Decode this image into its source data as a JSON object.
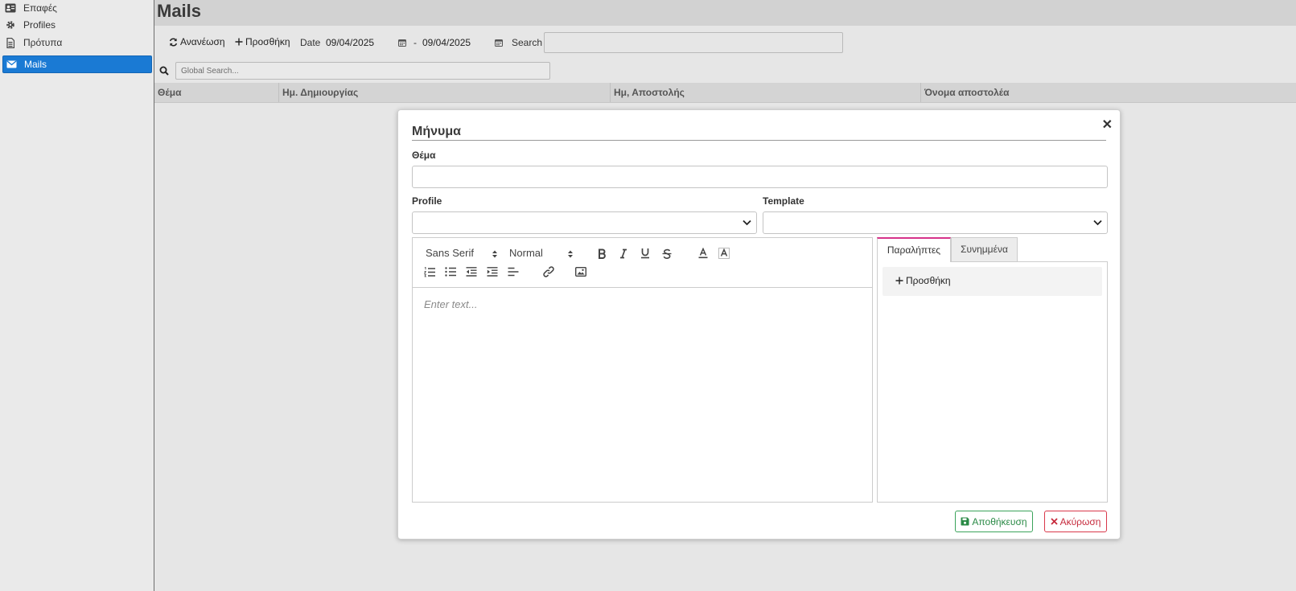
{
  "sidebar": {
    "items": [
      {
        "label": "Επαφές",
        "icon": "contacts-card-icon",
        "active": false
      },
      {
        "label": "Profiles",
        "icon": "gear-icon",
        "active": false
      },
      {
        "label": "Πρότυπα",
        "icon": "template-document-icon",
        "active": false
      },
      {
        "label": "Mails",
        "icon": "envelope-icon",
        "active": true
      }
    ]
  },
  "main": {
    "title": "Mails",
    "toolbar": {
      "refresh_label": "Ανανέωση",
      "add_label": "Προσθήκη",
      "date_label": "Date",
      "date_from": "09/04/2025",
      "date_separator": "-",
      "date_to": "09/04/2025",
      "search_label": "Search",
      "search_value": ""
    },
    "global_search": {
      "placeholder": "Global Search...",
      "value": ""
    },
    "table": {
      "columns": [
        "Θέμα",
        "Ημ. Δημιουργίας",
        "Ημ, Αποστολής",
        "Όνομα αποστολέα"
      ],
      "rows": []
    }
  },
  "modal": {
    "title": "Μήνυμα",
    "close_icon": "close-icon",
    "subject_label": "Θέμα",
    "subject_value": "",
    "profile_label": "Profile",
    "profile_value": "",
    "template_label": "Template",
    "template_value": "",
    "editor": {
      "font": "Sans Serif",
      "size": "Normal",
      "placeholder": "Enter text...",
      "content": ""
    },
    "tabs": [
      {
        "label": "Παραλήπτες",
        "active": true
      },
      {
        "label": "Συνημμένα",
        "active": false
      }
    ],
    "add_recipient_label": "Προσθήκη",
    "save_label": "Αποθήκευση",
    "cancel_label": "Ακύρωση"
  },
  "colors": {
    "accent": "#1a7ad4",
    "tab_active": "#d6338a",
    "save": "#2a8a46",
    "cancel": "#c62a3c"
  }
}
